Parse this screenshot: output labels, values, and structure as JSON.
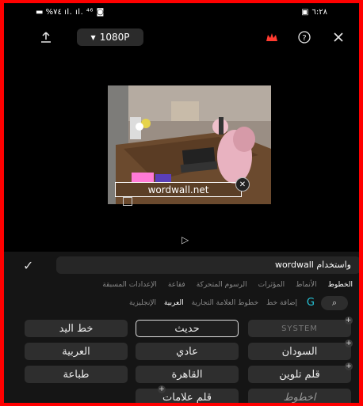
{
  "status": {
    "left_text": "%٧٤ ",
    "time": "٦:٢٨"
  },
  "toolbar": {
    "resolution": "1080P"
  },
  "preview": {
    "watermark_text": "wordwall.net"
  },
  "text_input": {
    "value": "واستخدام wordwall"
  },
  "tabs": [
    {
      "label": "الخطوط",
      "active": true
    },
    {
      "label": "الأنماط",
      "active": false
    },
    {
      "label": "المؤثرات",
      "active": false
    },
    {
      "label": "الرسوم المتحركة",
      "active": false
    },
    {
      "label": "فقاعة",
      "active": false
    },
    {
      "label": "الإعدادات المسبقة",
      "active": false
    }
  ],
  "subtabs": [
    {
      "label": "إضافة خط",
      "active": false
    },
    {
      "label": "خطوط العلامة التجارية",
      "active": false
    },
    {
      "label": "العربية",
      "active": true
    },
    {
      "label": "الإنجليزية",
      "active": false
    }
  ],
  "fonts": {
    "r1": [
      "SYSTEM",
      "حديث",
      "خط اليد"
    ],
    "r2": [
      "السودان",
      "عادي",
      "العربية"
    ],
    "r3": [
      "قلم تلوين",
      "القاهرة",
      "طباعة"
    ],
    "r4": [
      "اخطوط",
      "قلم علامات"
    ]
  },
  "colors": {
    "frame": "#ff0000",
    "accent_cyan": "#26c6da",
    "crown_red": "#ff3b30"
  }
}
